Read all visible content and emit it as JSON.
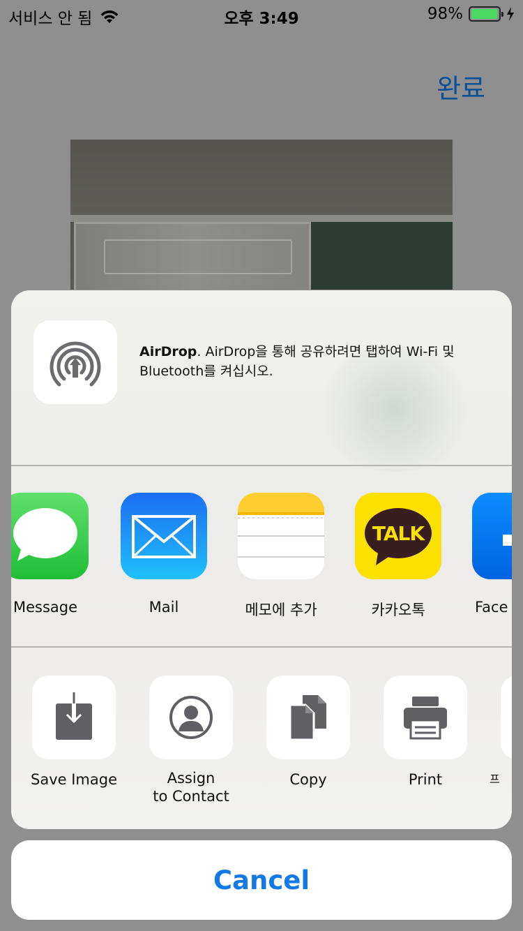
{
  "status_bar": {
    "carrier": "서비스 안 됨",
    "time": "오후 3:49",
    "battery_percent": "98%",
    "battery_level": 0.98,
    "icons": [
      "wifi-icon",
      "battery-icon",
      "charging-bolt-icon"
    ]
  },
  "header": {
    "done_label": "완료"
  },
  "airdrop": {
    "title": "AirDrop",
    "description": ". AirDrop을 통해 공유하려면 탭하여 Wi-Fi 및 Bluetooth를 켜십시오.",
    "icon": "airdrop-icon"
  },
  "apps": [
    {
      "label": "Message",
      "icon": "messages-icon",
      "color": "#34c759"
    },
    {
      "label": "Mail",
      "icon": "mail-icon",
      "color": "#1a8cf5"
    },
    {
      "label": "메모에 추가",
      "icon": "notes-icon",
      "color": "#ffd60a"
    },
    {
      "label": "카카오톡",
      "icon": "kakaotalk-icon",
      "color": "#fae100"
    },
    {
      "label": "Face",
      "icon": "facebook-icon",
      "color": "#1877f2"
    }
  ],
  "kakao_badge": "TALK",
  "actions": [
    {
      "label": "Save Image",
      "icon": "save-image-icon"
    },
    {
      "label": "Assign\nto Contact",
      "icon": "contact-icon"
    },
    {
      "label": "Copy",
      "icon": "copy-icon"
    },
    {
      "label": "Print",
      "icon": "print-icon"
    },
    {
      "label": "프",
      "icon": "more-icon"
    }
  ],
  "cancel_label": "Cancel",
  "colors": {
    "accent": "#1279e8",
    "done_link": "#0b4f96",
    "action_glyph": "#5f5f64"
  }
}
